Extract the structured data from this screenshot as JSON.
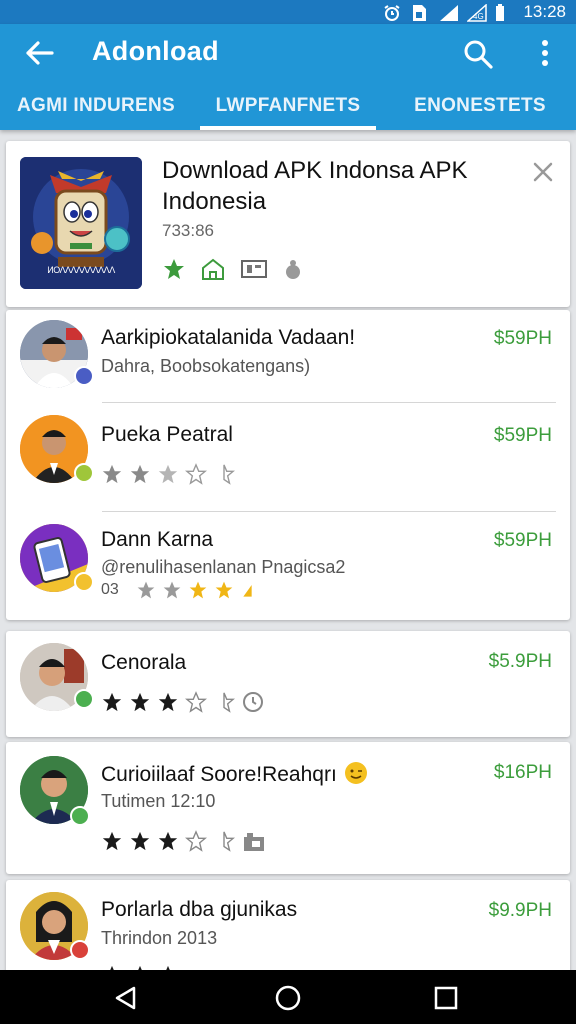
{
  "status_bar": {
    "time": "13:28",
    "icons": [
      "alarm-icon",
      "sim-icon",
      "signal-icon",
      "data-icon",
      "battery-icon"
    ]
  },
  "app_bar": {
    "title": "Adonload",
    "tabs": [
      {
        "label": "AGMI INDURENS",
        "active": false
      },
      {
        "label": "LWPFANFNETS",
        "active": true
      },
      {
        "label": "ENONESTETS",
        "active": false
      }
    ]
  },
  "featured": {
    "title": "Download APK Indonsa APK Indonesia",
    "size": "733:86",
    "icon_caption": "ИΟΛΛΛΛΛΛΛΛΛΛ"
  },
  "list_items": [
    {
      "name": "Aarkipiokatalanida Vadaan!",
      "subtitle": "Dahra, Boobsokatengans)",
      "price": "$59PH",
      "stars": null,
      "avatar_bg": "#7a8aa5",
      "badge_color": "#4a5dc4"
    },
    {
      "name": "Pueka Peatral",
      "subtitle": "",
      "price": "$59PH",
      "stars": "2 of 5",
      "avatar_bg": "#f29421",
      "badge_color": "#9fc63a"
    },
    {
      "name": "Dann Karna",
      "subtitle": "@renulihasenlanan Pnagicsa2",
      "secondary": "03",
      "price": "$59PH",
      "stars": "3 of 5",
      "avatar_bg": "#7a2fc0",
      "badge_color": "#f2c12e"
    },
    {
      "name": "Cenorala",
      "subtitle": "",
      "price": "$5.9PH",
      "stars": "3 of 5",
      "avatar_bg": "#c9c2bb",
      "badge_color": "#4caf50"
    },
    {
      "name": "Curioiilaaf Soore!Reahqrı",
      "subtitle": "Tutimen 12:10",
      "price": "$16PH",
      "stars": "3 of 5",
      "avatar_bg": "#2f7a3b",
      "badge_color": "#4caf50"
    },
    {
      "name": "Porlarla dba gjunikas",
      "subtitle": "Thrindon 2013",
      "price": "$9.9PH",
      "stars": "3 of 5",
      "avatar_bg": "#dcb23b",
      "badge_color": "#d9413a"
    }
  ],
  "colors": {
    "primary": "#2196d6",
    "primary_dark": "#1c79c0",
    "price_green": "#3c9d3c",
    "star_green": "#3d9b3d",
    "star_yellow": "#f0b616"
  }
}
